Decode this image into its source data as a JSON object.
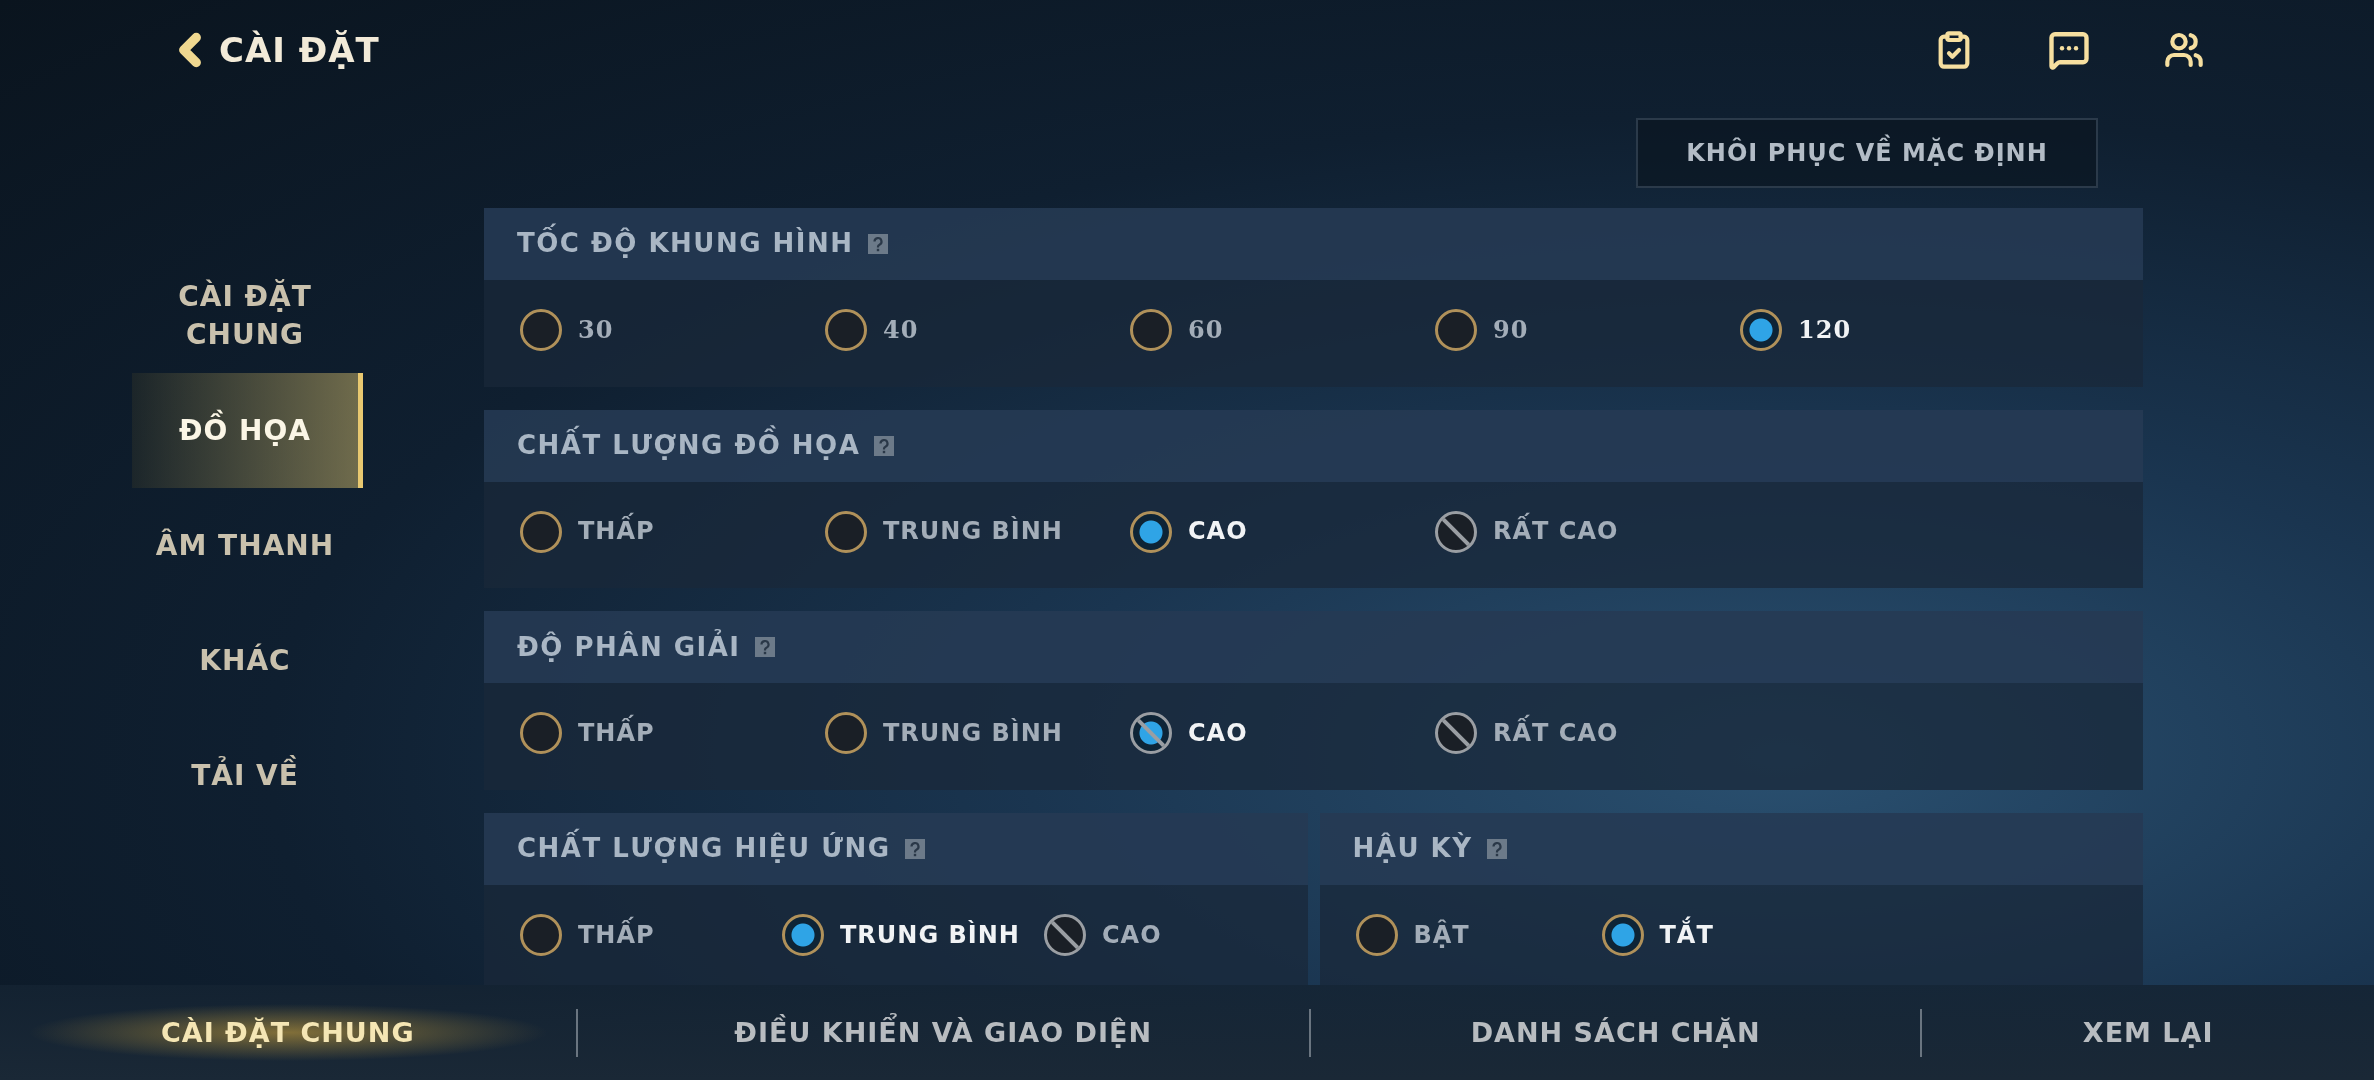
{
  "header": {
    "title": "CÀI ĐẶT"
  },
  "restore_button": "KHÔI PHỤC VỀ MẶC ĐỊNH",
  "sidebar": {
    "items": [
      {
        "label": "CÀI ĐẶT CHUNG",
        "selected": false
      },
      {
        "label": "ĐỒ HỌA",
        "selected": true
      },
      {
        "label": "ÂM THANH",
        "selected": false
      },
      {
        "label": "KHÁC",
        "selected": false
      },
      {
        "label": "TẢI VỀ",
        "selected": false
      }
    ]
  },
  "sections": [
    {
      "title": "TỐC ĐỘ KHUNG HÌNH",
      "kind": "numeric",
      "options": [
        {
          "label": "30",
          "selected": false,
          "disabled": false
        },
        {
          "label": "40",
          "selected": false,
          "disabled": false
        },
        {
          "label": "60",
          "selected": false,
          "disabled": false
        },
        {
          "label": "90",
          "selected": false,
          "disabled": false
        },
        {
          "label": "120",
          "selected": true,
          "disabled": false
        }
      ]
    },
    {
      "title": "CHẤT LƯỢNG ĐỒ HỌA",
      "kind": "text",
      "options": [
        {
          "label": "THẤP",
          "selected": false,
          "disabled": false
        },
        {
          "label": "TRUNG BÌNH",
          "selected": false,
          "disabled": false
        },
        {
          "label": "CAO",
          "selected": true,
          "disabled": false
        },
        {
          "label": "RẤT CAO",
          "selected": false,
          "disabled": true
        }
      ]
    },
    {
      "title": "ĐỘ PHÂN GIẢI",
      "kind": "text",
      "options": [
        {
          "label": "THẤP",
          "selected": false,
          "disabled": false
        },
        {
          "label": "TRUNG BÌNH",
          "selected": false,
          "disabled": false
        },
        {
          "label": "CAO",
          "selected": true,
          "disabled": true
        },
        {
          "label": "RẤT CAO",
          "selected": false,
          "disabled": true
        }
      ]
    }
  ],
  "paired_sections": [
    {
      "title": "CHẤT LƯỢNG HIỆU ỨNG",
      "options": [
        {
          "label": "THẤP",
          "selected": false,
          "disabled": false
        },
        {
          "label": "TRUNG BÌNH",
          "selected": true,
          "disabled": false
        },
        {
          "label": "CAO",
          "selected": false,
          "disabled": true
        }
      ]
    },
    {
      "title": "HẬU KỲ",
      "options": [
        {
          "label": "BẬT",
          "selected": false,
          "disabled": false
        },
        {
          "label": "TẮT",
          "selected": true,
          "disabled": false
        }
      ]
    }
  ],
  "bottom_tabs": [
    {
      "label": "CÀI ĐẶT CHUNG",
      "selected": true
    },
    {
      "label": "ĐIỀU KHIỂN VÀ GIAO DIỆN",
      "selected": false
    },
    {
      "label": "DANH SÁCH CHẶN",
      "selected": false
    },
    {
      "label": "XEM LẠI",
      "selected": false
    }
  ]
}
